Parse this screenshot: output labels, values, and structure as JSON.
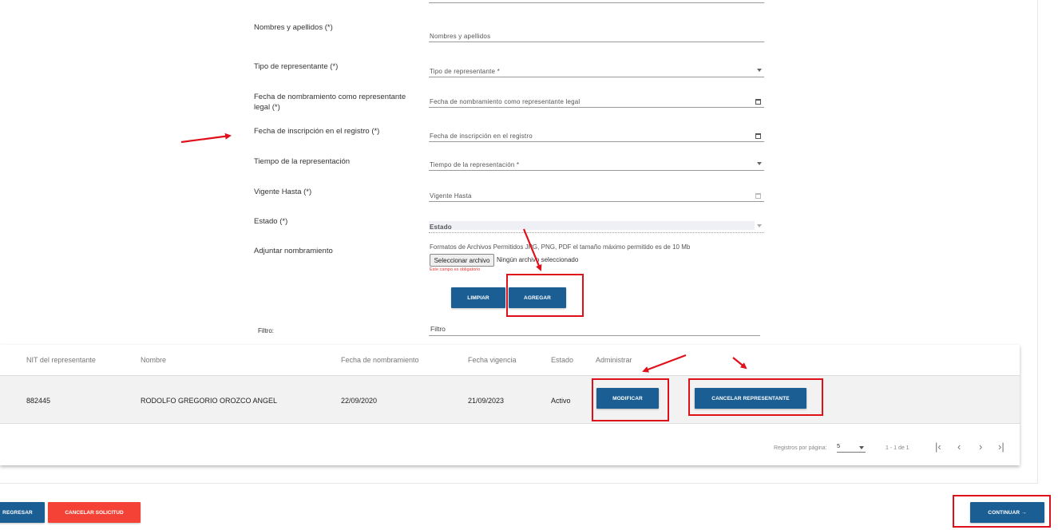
{
  "form": {
    "nombres_label": "Nombres y apellidos (*)",
    "nombres_placeholder": "Nombres y apellidos",
    "tipo_label": "Tipo de representante (*)",
    "tipo_placeholder": "Tipo de representante *",
    "fecha_nombramiento_label": "Fecha de nombramiento como representante legal (*)",
    "fecha_nombramiento_placeholder": "Fecha de nombramiento como representante legal",
    "fecha_inscripcion_label": "Fecha de inscripción en el registro (*)",
    "fecha_inscripcion_placeholder": "Fecha de inscripción en el registro",
    "tiempo_label": "Tiempo de la representación",
    "tiempo_placeholder": "Tiempo de la representación *",
    "vigente_label": "Vigente Hasta (*)",
    "vigente_placeholder": "Vigente Hasta",
    "estado_label": "Estado (*)",
    "estado_placeholder": "Estado",
    "adjuntar_label": "Adjuntar nombramiento",
    "file_note": "Formatos de Archivos Permitidos JPG, PNG, PDF el tamaño máximo permitido es de 10 Mb",
    "file_button": "Seleccionar archivo",
    "file_none": "Ningún archivo seleccionado",
    "file_error": "Este campo es obligatorio",
    "limpiar": "LIMPIAR",
    "agregar": "AGREGAR",
    "filtro_label": "Filtro:",
    "filtro_placeholder": "Filtro"
  },
  "table": {
    "headers": [
      "NIT del representante",
      "Nombre",
      "Fecha de nombramiento",
      "Fecha vigencia",
      "Estado",
      "Administrar"
    ],
    "rows": [
      {
        "nit": "882445",
        "nombre": "RODOLFO GREGORIO OROZCO ANGEL",
        "fecha_nombramiento": "22/09/2020",
        "fecha_vigencia": "21/09/2023",
        "estado": "Activo",
        "modificar": "MODIFICAR",
        "cancelar": "CANCELAR REPRESENTANTE"
      }
    ],
    "pager": {
      "per_page_label": "Registros por página:",
      "per_page_value": "5",
      "range": "1 - 1 de 1"
    }
  },
  "footer": {
    "regresar": "REGRESAR",
    "cancelar_solicitud": "CANCELAR SOLICITUD",
    "continuar": "CONTINUAR →"
  },
  "colors": {
    "primary": "#1b5e94",
    "danger": "#f44336",
    "annotation": "#e0101a"
  }
}
